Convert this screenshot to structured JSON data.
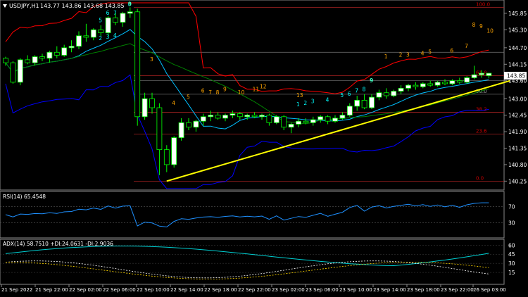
{
  "header": {
    "symbol": "USDJPY,H1",
    "ohlc": "143.77 143.86 143.68 143.85"
  },
  "price_axis": {
    "ticks": [
      "145.85",
      "145.30",
      "144.70",
      "144.15",
      "143.60",
      "143.00",
      "142.45",
      "141.90",
      "141.35",
      "140.80",
      "140.25"
    ],
    "current_price": "143.85"
  },
  "fib_levels": [
    {
      "label": "100.0"
    },
    {
      "label": "61.8"
    },
    {
      "label": "50.0"
    },
    {
      "label": "38.2"
    },
    {
      "label": "23.6"
    },
    {
      "label": "0.0"
    }
  ],
  "time_axis": {
    "ticks": [
      "21 Sep 2022",
      "21 Sep 22:00",
      "22 Sep 02:00",
      "22 Sep 06:00",
      "22 Sep 10:00",
      "22 Sep 14:00",
      "22 Sep 18:00",
      "22 Sep 22:00",
      "23 Sep 02:00",
      "23 Sep 06:00",
      "23 Sep 10:00",
      "23 Sep 14:00",
      "23 Sep 18:00",
      "23 Sep 22:00",
      "26 Sep 03:00"
    ]
  },
  "rsi_panel": {
    "label": "RSI(14) 65.4548",
    "ticks": [
      "70",
      "30"
    ]
  },
  "adx_panel": {
    "label": "ADX(14) 58.7510  +DI:24.0631  -DI:2.9036",
    "ticks": [
      "60",
      "45",
      "30",
      "15"
    ]
  },
  "colors": {
    "background": "#000000",
    "bull": "#ffffff",
    "bear": "#000000",
    "wick": "#00ff00",
    "trendline": "#ffff00",
    "upper_band": "#ff0000",
    "lower_band": "#0000ff",
    "middle_band": "#00bfff",
    "ma": "#008000",
    "rsi": "#1e90ff",
    "adx": "#00ced1",
    "plus_di": "#ffffff",
    "minus_di": "#ffd700",
    "seq_up": "#00ffff",
    "seq_down": "#ffa500"
  },
  "chart_data": {
    "type": "candlestick",
    "symbol": "USDJPY",
    "timeframe": "H1",
    "ylim": [
      140.0,
      146.2
    ],
    "candles": [
      [
        144.35,
        144.4,
        144.1,
        144.2
      ],
      [
        144.2,
        144.25,
        143.5,
        143.55
      ],
      [
        143.55,
        144.35,
        143.45,
        144.3
      ],
      [
        144.3,
        144.45,
        144.15,
        144.2
      ],
      [
        144.2,
        144.45,
        144.1,
        144.4
      ],
      [
        144.4,
        144.5,
        144.25,
        144.35
      ],
      [
        144.35,
        144.6,
        144.2,
        144.55
      ],
      [
        144.55,
        144.75,
        144.35,
        144.45
      ],
      [
        144.45,
        144.8,
        144.4,
        144.7
      ],
      [
        144.7,
        144.95,
        144.55,
        144.75
      ],
      [
        144.75,
        145.25,
        144.65,
        145.1
      ],
      [
        145.1,
        145.5,
        144.9,
        145.05
      ],
      [
        145.05,
        145.35,
        144.95,
        145.3
      ],
      [
        145.3,
        145.45,
        145.1,
        145.2
      ],
      [
        145.2,
        145.75,
        145.1,
        145.7
      ],
      [
        145.7,
        145.85,
        145.45,
        145.55
      ],
      [
        145.55,
        145.9,
        145.4,
        145.85
      ],
      [
        145.85,
        146.05,
        145.7,
        145.9
      ],
      [
        145.9,
        146.0,
        142.1,
        142.4
      ],
      [
        142.4,
        143.2,
        142.3,
        143.0
      ],
      [
        143.0,
        143.2,
        142.5,
        142.7
      ],
      [
        142.7,
        142.85,
        140.45,
        141.3
      ],
      [
        141.3,
        141.45,
        140.55,
        140.8
      ],
      [
        140.8,
        141.75,
        140.7,
        141.7
      ],
      [
        141.7,
        142.35,
        141.6,
        142.2
      ],
      [
        142.2,
        142.35,
        141.95,
        142.05
      ],
      [
        142.05,
        142.3,
        141.9,
        142.25
      ],
      [
        142.25,
        142.5,
        142.1,
        142.4
      ],
      [
        142.4,
        142.6,
        142.25,
        142.45
      ],
      [
        142.45,
        142.55,
        142.3,
        142.35
      ],
      [
        142.35,
        142.5,
        142.25,
        142.45
      ],
      [
        142.45,
        142.6,
        142.35,
        142.5
      ],
      [
        142.5,
        142.55,
        142.3,
        142.4
      ],
      [
        142.4,
        142.5,
        142.3,
        142.45
      ],
      [
        142.45,
        142.55,
        142.35,
        142.4
      ],
      [
        142.4,
        142.5,
        142.3,
        142.45
      ],
      [
        142.45,
        142.5,
        142.1,
        142.2
      ],
      [
        142.2,
        142.45,
        142.15,
        142.4
      ],
      [
        142.4,
        142.45,
        141.95,
        142.05
      ],
      [
        142.05,
        142.2,
        141.85,
        142.15
      ],
      [
        142.15,
        142.35,
        142.05,
        142.25
      ],
      [
        142.25,
        142.35,
        142.15,
        142.2
      ],
      [
        142.2,
        142.4,
        142.1,
        142.3
      ],
      [
        142.3,
        142.45,
        142.2,
        142.4
      ],
      [
        142.4,
        142.45,
        142.15,
        142.25
      ],
      [
        142.25,
        142.45,
        142.2,
        142.35
      ],
      [
        142.35,
        142.55,
        142.3,
        142.45
      ],
      [
        142.45,
        142.85,
        142.4,
        142.75
      ],
      [
        142.75,
        143.1,
        142.6,
        142.95
      ],
      [
        142.95,
        143.15,
        142.65,
        142.7
      ],
      [
        142.7,
        143.15,
        142.65,
        143.05
      ],
      [
        143.05,
        143.3,
        142.95,
        143.2
      ],
      [
        143.2,
        143.35,
        143.0,
        143.1
      ],
      [
        143.1,
        143.3,
        143.05,
        143.25
      ],
      [
        143.25,
        143.45,
        143.15,
        143.35
      ],
      [
        143.35,
        143.5,
        143.25,
        143.45
      ],
      [
        143.45,
        143.55,
        143.3,
        143.4
      ],
      [
        143.4,
        143.55,
        143.35,
        143.5
      ],
      [
        143.5,
        143.6,
        143.4,
        143.45
      ],
      [
        143.45,
        143.6,
        143.4,
        143.55
      ],
      [
        143.55,
        143.65,
        143.45,
        143.5
      ],
      [
        143.5,
        143.65,
        143.45,
        143.6
      ],
      [
        143.6,
        143.7,
        143.5,
        143.55
      ],
      [
        143.55,
        143.75,
        143.5,
        143.7
      ],
      [
        143.7,
        144.1,
        143.65,
        143.8
      ],
      [
        143.8,
        143.95,
        143.7,
        143.85
      ],
      [
        143.77,
        143.86,
        143.68,
        143.85
      ]
    ],
    "trendline": [
      [
        22,
        140.25
      ],
      [
        66,
        143.55
      ]
    ],
    "sequence_labels": {
      "up": [
        "2",
        "3",
        "4",
        "5",
        "6",
        "7",
        "8",
        "9",
        "1",
        "2",
        "3",
        "4",
        "5",
        "6",
        "7",
        "8",
        "9"
      ],
      "down": [
        "3",
        "4",
        "5",
        "6",
        "7",
        "8",
        "9",
        "10",
        "11",
        "12",
        "13",
        "1",
        "2",
        "3",
        "4",
        "5",
        "6",
        "7",
        "8",
        "9",
        "10"
      ]
    },
    "rsi": {
      "ylim": [
        0,
        100
      ],
      "levels": [
        70,
        30
      ]
    },
    "adx": {
      "ylim": [
        0,
        65
      ],
      "levels": [
        60,
        45,
        30,
        15
      ]
    }
  }
}
